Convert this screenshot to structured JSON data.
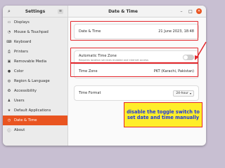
{
  "sidebar": {
    "title": "Settings",
    "items": [
      {
        "icon": "display-icon",
        "glyph": "▭",
        "label": "Displays"
      },
      {
        "icon": "mouse-icon",
        "glyph": "◔",
        "label": "Mouse & Touchpad"
      },
      {
        "icon": "keyboard-icon",
        "glyph": "⌨",
        "label": "Keyboard"
      },
      {
        "icon": "printer-icon",
        "glyph": "⎙",
        "label": "Printers"
      },
      {
        "icon": "removable-media-icon",
        "glyph": "▣",
        "label": "Removable Media"
      },
      {
        "icon": "color-icon",
        "glyph": "●",
        "label": "Color"
      },
      {
        "icon": "globe-icon",
        "glyph": "◍",
        "label": "Region & Language"
      },
      {
        "icon": "accessibility-icon",
        "glyph": "✪",
        "label": "Accessibility"
      },
      {
        "icon": "users-icon",
        "glyph": "♟",
        "label": "Users"
      },
      {
        "icon": "star-icon",
        "glyph": "★",
        "label": "Default Applications"
      },
      {
        "icon": "clock-icon",
        "glyph": "◷",
        "label": "Date & Time",
        "active": true
      },
      {
        "icon": "info-icon",
        "glyph": "ⓘ",
        "label": "About"
      }
    ]
  },
  "header": {
    "title": "Date & Time"
  },
  "main": {
    "date_time_label": "Date & Time",
    "date_time_value": "21 June 2023, 18:48",
    "auto_tz_label": "Automatic Time Zone",
    "auto_tz_sub": "Requires location services enabled and internet access",
    "time_zone_label": "Time Zone",
    "time_zone_value": "PKT (Karachi, Pakistan)",
    "time_format_label": "Time Format",
    "time_format_value": "24-hour"
  },
  "annotation": {
    "text": "disable the toggle switch to set date and time manually",
    "highlight_color": "#e3262b",
    "note_bg": "#ffee2a",
    "note_text_color": "#1d39e0"
  },
  "colors": {
    "accent": "#e95420"
  }
}
